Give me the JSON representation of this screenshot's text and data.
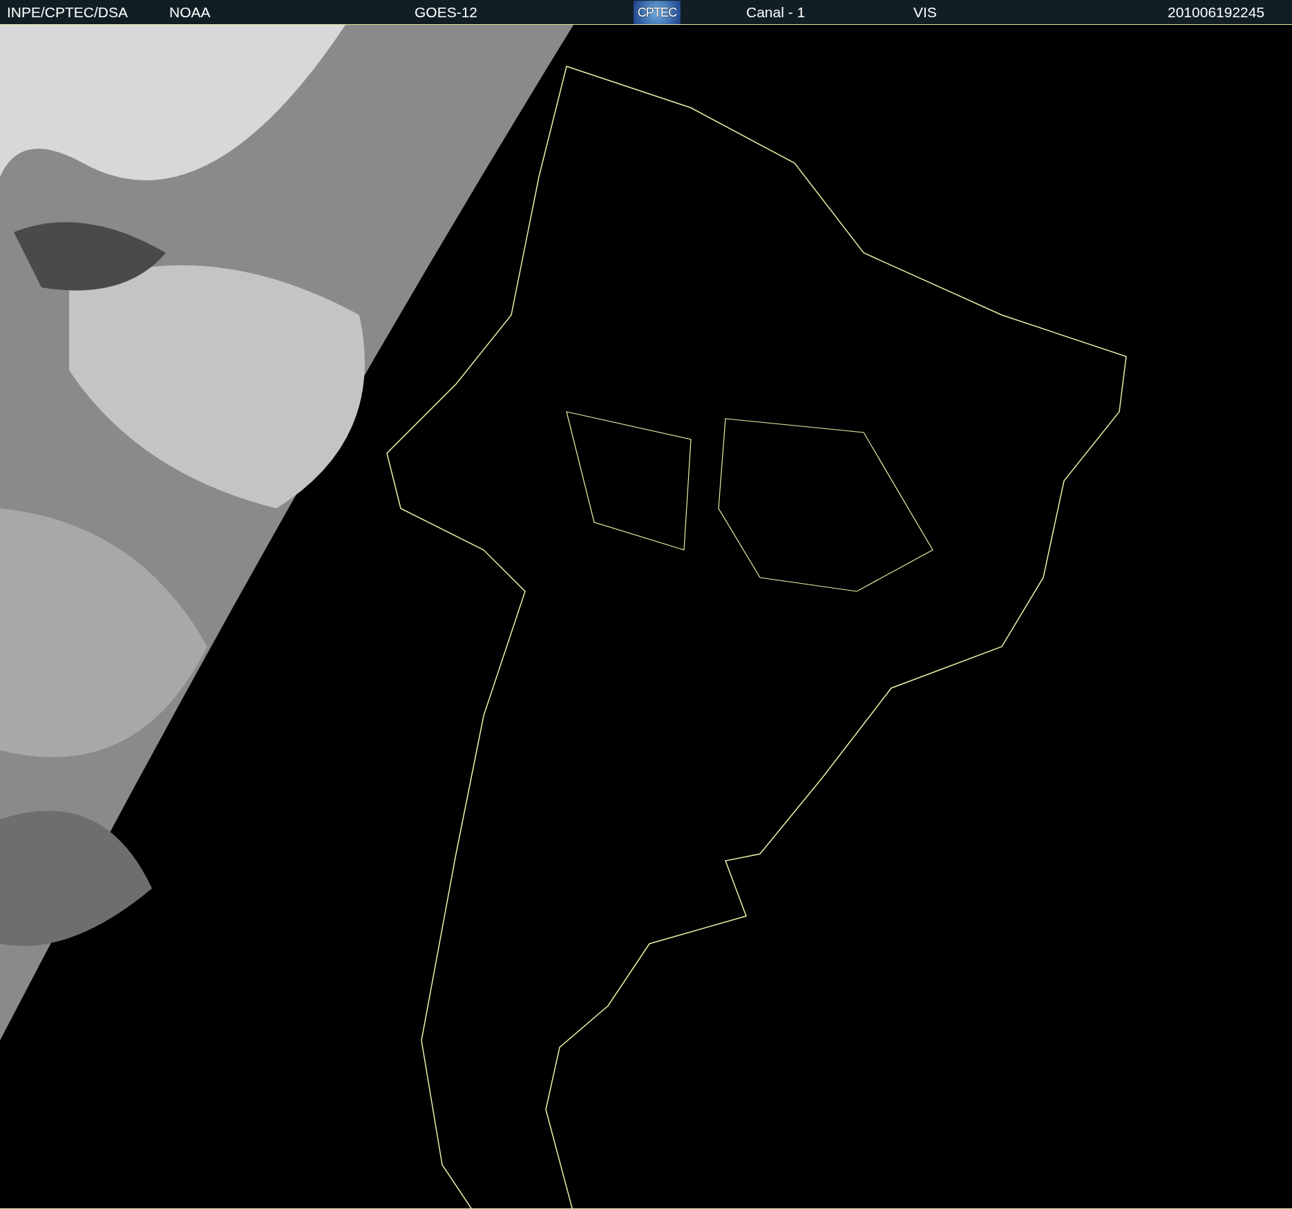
{
  "header": {
    "source": "INPE/CPTEC/DSA",
    "agency": "NOAA",
    "satellite": "GOES-12",
    "logo": "CPTEC",
    "channel": "Canal - 1",
    "band": "VIS",
    "timestamp": "201006192245"
  }
}
